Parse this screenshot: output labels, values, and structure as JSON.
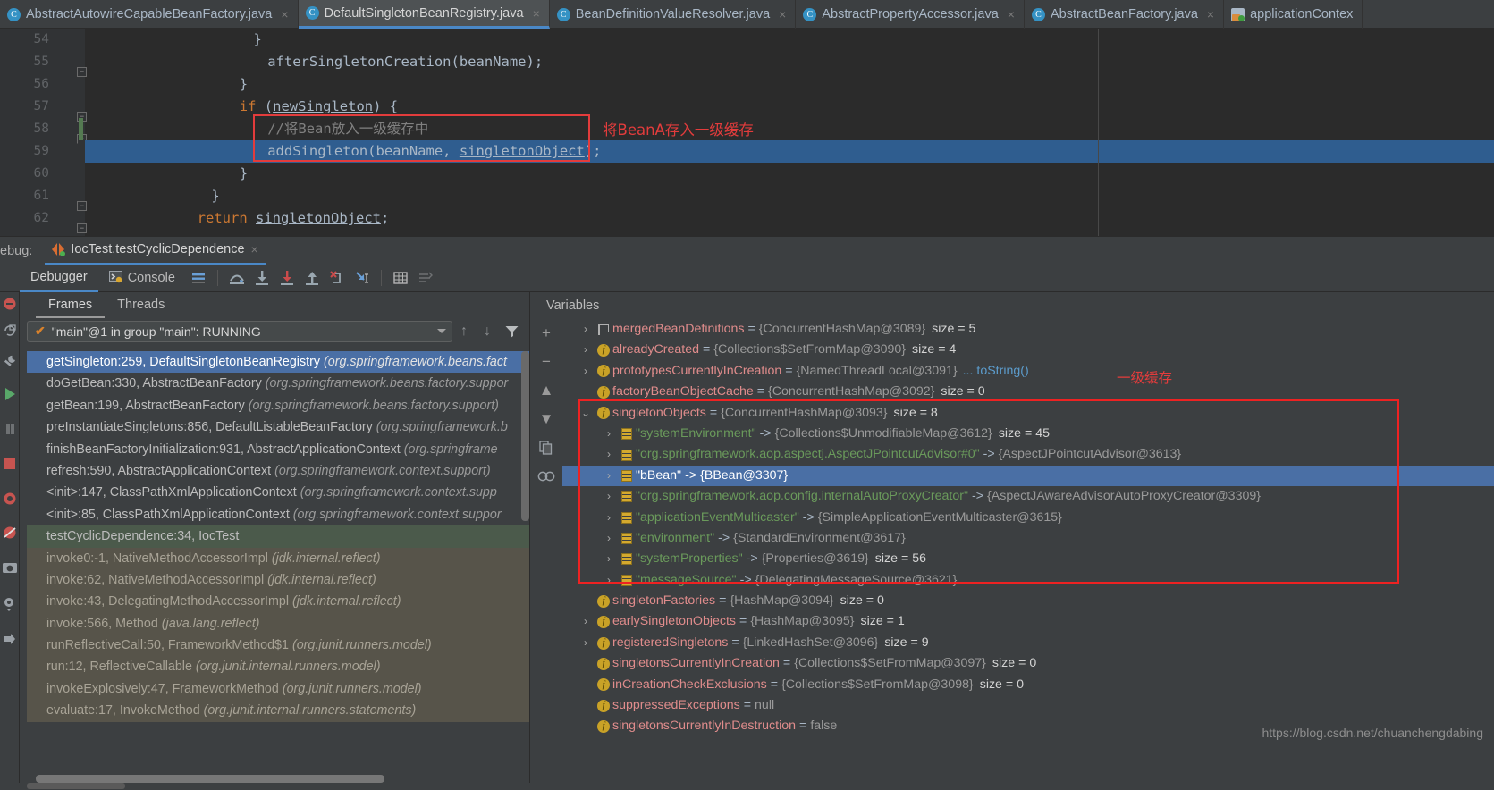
{
  "editor_tabs": [
    {
      "label": "AbstractAutowireCapableBeanFactory.java",
      "icon": "java-class-icon",
      "active": false,
      "close": "×"
    },
    {
      "label": "DefaultSingletonBeanRegistry.java",
      "icon": "java-class-icon",
      "active": true,
      "close": "×"
    },
    {
      "label": "BeanDefinitionValueResolver.java",
      "icon": "java-class-icon",
      "active": false,
      "close": "×"
    },
    {
      "label": "AbstractPropertyAccessor.java",
      "icon": "java-class-icon",
      "active": false,
      "close": "×"
    },
    {
      "label": "AbstractBeanFactory.java",
      "icon": "java-class-icon",
      "active": false,
      "close": "×"
    },
    {
      "label": "applicationContex",
      "icon": "xml-spring-icon",
      "active": false,
      "close": ""
    }
  ],
  "editor": {
    "line_numbers": [
      "54",
      "55",
      "56",
      "57",
      "58",
      "59",
      "60",
      "61",
      "62"
    ],
    "lines": [
      {
        "indent": 48,
        "text": "}"
      },
      {
        "indent": 52,
        "text": "afterSingletonCreation(beanName);"
      },
      {
        "indent": 44,
        "text": "}"
      },
      {
        "indent": 44,
        "text": "if (newSingleton) {",
        "kw": "if",
        "undl": "newSingleton"
      },
      {
        "indent": 52,
        "text": "//将Bean放入一级缓存中",
        "comment": true
      },
      {
        "indent": 52,
        "text": "addSingleton(beanName, singletonObject);",
        "undl": "singletonObject",
        "executing": true
      },
      {
        "indent": 44,
        "text": "}"
      },
      {
        "indent": 36,
        "text": "}"
      },
      {
        "indent": 32,
        "text": "return singletonObject;",
        "kw": "return",
        "undl": "singletonObject"
      }
    ],
    "annotation": "将BeanA存入一级缓存"
  },
  "debug_window": {
    "label": "ebug:",
    "run_tab": "IocTest.testCyclicDependence",
    "run_tab_close": "×",
    "tabs": [
      {
        "label": "Debugger",
        "selected": true,
        "icon": ""
      },
      {
        "label": "Console",
        "selected": false,
        "icon": "console-icon"
      }
    ],
    "toolbar_icons": [
      "layout-lines-icon",
      "step-over-icon",
      "step-into-icon",
      "force-step-into-icon",
      "step-out-icon",
      "drop-frame-icon",
      "run-to-cursor-icon",
      "evaluate-expression-icon",
      "show-types-icon"
    ]
  },
  "frames": {
    "tabs": [
      {
        "label": "Frames",
        "selected": true
      },
      {
        "label": "Threads",
        "selected": false
      }
    ],
    "thread_selector": {
      "value": "\"main\"@1 in group \"main\": RUNNING",
      "status_icon": "orange-check-icon"
    },
    "toolbar": [
      "arrow-up-icon",
      "arrow-down-icon",
      "filter-icon"
    ],
    "items": [
      {
        "method": "getSingleton:259, DefaultSingletonBeanRegistry ",
        "pkg": "(org.springframework.beans.fact",
        "state": "sel"
      },
      {
        "method": "doGetBean:330, AbstractBeanFactory ",
        "pkg": "(org.springframework.beans.factory.suppor",
        "state": ""
      },
      {
        "method": "getBean:199, AbstractBeanFactory ",
        "pkg": "(org.springframework.beans.factory.support)",
        "state": ""
      },
      {
        "method": "preInstantiateSingletons:856, DefaultListableBeanFactory ",
        "pkg": "(org.springframework.b",
        "state": ""
      },
      {
        "method": "finishBeanFactoryInitialization:931, AbstractApplicationContext ",
        "pkg": "(org.springframe",
        "state": ""
      },
      {
        "method": "refresh:590, AbstractApplicationContext ",
        "pkg": "(org.springframework.context.support)",
        "state": ""
      },
      {
        "method": "<init>:147, ClassPathXmlApplicationContext ",
        "pkg": "(org.springframework.context.supp",
        "state": ""
      },
      {
        "method": "<init>:85, ClassPathXmlApplicationContext ",
        "pkg": "(org.springframework.context.suppor",
        "state": ""
      },
      {
        "method": "testCyclicDependence:34, IocTest",
        "pkg": "",
        "state": "mine"
      },
      {
        "method": "invoke0:-1, NativeMethodAccessorImpl ",
        "pkg": "(jdk.internal.reflect)",
        "state": "dim"
      },
      {
        "method": "invoke:62, NativeMethodAccessorImpl ",
        "pkg": "(jdk.internal.reflect)",
        "state": "dim"
      },
      {
        "method": "invoke:43, DelegatingMethodAccessorImpl ",
        "pkg": "(jdk.internal.reflect)",
        "state": "dim"
      },
      {
        "method": "invoke:566, Method ",
        "pkg": "(java.lang.reflect)",
        "state": "dim"
      },
      {
        "method": "runReflectiveCall:50, FrameworkMethod$1 ",
        "pkg": "(org.junit.runners.model)",
        "state": "dim"
      },
      {
        "method": "run:12, ReflectiveCallable ",
        "pkg": "(org.junit.internal.runners.model)",
        "state": "dim"
      },
      {
        "method": "invokeExplosively:47, FrameworkMethod ",
        "pkg": "(org.junit.runners.model)",
        "state": "dim"
      },
      {
        "method": "evaluate:17, InvokeMethod ",
        "pkg": "(org.junit.internal.runners.statements)",
        "state": "dim"
      }
    ]
  },
  "variables": {
    "header": "Variables",
    "rail_icons": [
      "add-icon",
      "remove-icon",
      "scroll-up-icon",
      "scroll-down-icon",
      "copy-icon",
      "watches-icon"
    ],
    "annotation": "一级缓存",
    "rows": [
      {
        "twist": "›",
        "icon": "flag-icon",
        "name": "mergedBeanDefinitions",
        "eq": "=",
        "value": "{ConcurrentHashMap@3089}",
        "size": "size = 5",
        "indent": 0,
        "kind": "field",
        "sel": false
      },
      {
        "twist": "›",
        "icon": "field-icon",
        "name": "alreadyCreated",
        "eq": "=",
        "value": "{Collections$SetFromMap@3090}",
        "size": "size = 4",
        "indent": 0,
        "kind": "field",
        "sel": false
      },
      {
        "twist": "›",
        "icon": "field-icon",
        "name": "prototypesCurrentlyInCreation",
        "eq": "=",
        "value": "{NamedThreadLocal@3091}",
        "size": "",
        "link": "... toString()",
        "indent": 0,
        "kind": "field",
        "sel": false
      },
      {
        "twist": "",
        "icon": "field-icon",
        "name": "factoryBeanObjectCache",
        "eq": "=",
        "value": "{ConcurrentHashMap@3092}",
        "size": "size = 0",
        "indent": 0,
        "kind": "field",
        "sel": false
      },
      {
        "twist": "⌄",
        "icon": "field-icon",
        "name": "singletonObjects",
        "eq": "=",
        "value": "{ConcurrentHashMap@3093}",
        "size": "size = 8",
        "indent": 0,
        "kind": "field",
        "sel": false
      },
      {
        "twist": "›",
        "icon": "entry-icon",
        "name": "\"systemEnvironment\"",
        "eq": "->",
        "value": "{Collections$UnmodifiableMap@3612}",
        "size": "size = 45",
        "indent": 1,
        "kind": "entry",
        "sel": false
      },
      {
        "twist": "›",
        "icon": "entry-icon",
        "name": "\"org.springframework.aop.aspectj.AspectJPointcutAdvisor#0\"",
        "eq": "->",
        "value": "{AspectJPointcutAdvisor@3613}",
        "size": "",
        "indent": 1,
        "kind": "entry",
        "sel": false
      },
      {
        "twist": "›",
        "icon": "entry-icon",
        "name": "\"bBean\"",
        "eq": "->",
        "value": "{BBean@3307}",
        "size": "",
        "indent": 1,
        "kind": "entry",
        "sel": true
      },
      {
        "twist": "›",
        "icon": "entry-icon",
        "name": "\"org.springframework.aop.config.internalAutoProxyCreator\"",
        "eq": "->",
        "value": "{AspectJAwareAdvisorAutoProxyCreator@3309}",
        "size": "",
        "indent": 1,
        "kind": "entry",
        "sel": false
      },
      {
        "twist": "›",
        "icon": "entry-icon",
        "name": "\"applicationEventMulticaster\"",
        "eq": "->",
        "value": "{SimpleApplicationEventMulticaster@3615}",
        "size": "",
        "indent": 1,
        "kind": "entry",
        "sel": false
      },
      {
        "twist": "›",
        "icon": "entry-icon",
        "name": "\"environment\"",
        "eq": "->",
        "value": "{StandardEnvironment@3617}",
        "size": "",
        "indent": 1,
        "kind": "entry",
        "sel": false
      },
      {
        "twist": "›",
        "icon": "entry-icon",
        "name": "\"systemProperties\"",
        "eq": "->",
        "value": "{Properties@3619}",
        "size": "size = 56",
        "indent": 1,
        "kind": "entry",
        "sel": false
      },
      {
        "twist": "›",
        "icon": "entry-icon",
        "name": "\"messageSource\"",
        "eq": "->",
        "value": "{DelegatingMessageSource@3621}",
        "size": "",
        "indent": 1,
        "kind": "entry",
        "sel": false
      },
      {
        "twist": "",
        "icon": "field-icon",
        "name": "singletonFactories",
        "eq": "=",
        "value": "{HashMap@3094}",
        "size": "size = 0",
        "indent": 0,
        "kind": "field",
        "sel": false
      },
      {
        "twist": "›",
        "icon": "field-icon",
        "name": "earlySingletonObjects",
        "eq": "=",
        "value": "{HashMap@3095}",
        "size": "size = 1",
        "indent": 0,
        "kind": "field",
        "sel": false
      },
      {
        "twist": "›",
        "icon": "field-icon",
        "name": "registeredSingletons",
        "eq": "=",
        "value": "{LinkedHashSet@3096}",
        "size": "size = 9",
        "indent": 0,
        "kind": "field",
        "sel": false
      },
      {
        "twist": "",
        "icon": "field-icon",
        "name": "singletonsCurrentlyInCreation",
        "eq": "=",
        "value": "{Collections$SetFromMap@3097}",
        "size": "size = 0",
        "indent": 0,
        "kind": "field",
        "sel": false
      },
      {
        "twist": "",
        "icon": "field-icon",
        "name": "inCreationCheckExclusions",
        "eq": "=",
        "value": "{Collections$SetFromMap@3098}",
        "size": "size = 0",
        "indent": 0,
        "kind": "field",
        "sel": false
      },
      {
        "twist": "",
        "icon": "field-icon",
        "name": "suppressedExceptions",
        "eq": "=",
        "value": "null",
        "size": "",
        "indent": 0,
        "kind": "field",
        "sel": false
      },
      {
        "twist": "",
        "icon": "field-icon",
        "name": "singletonsCurrentlyInDestruction",
        "eq": "=",
        "value": "false",
        "size": "",
        "indent": 0,
        "kind": "field",
        "sel": false
      }
    ]
  },
  "watermark": "https://blog.csdn.net/chuanchengdabing"
}
